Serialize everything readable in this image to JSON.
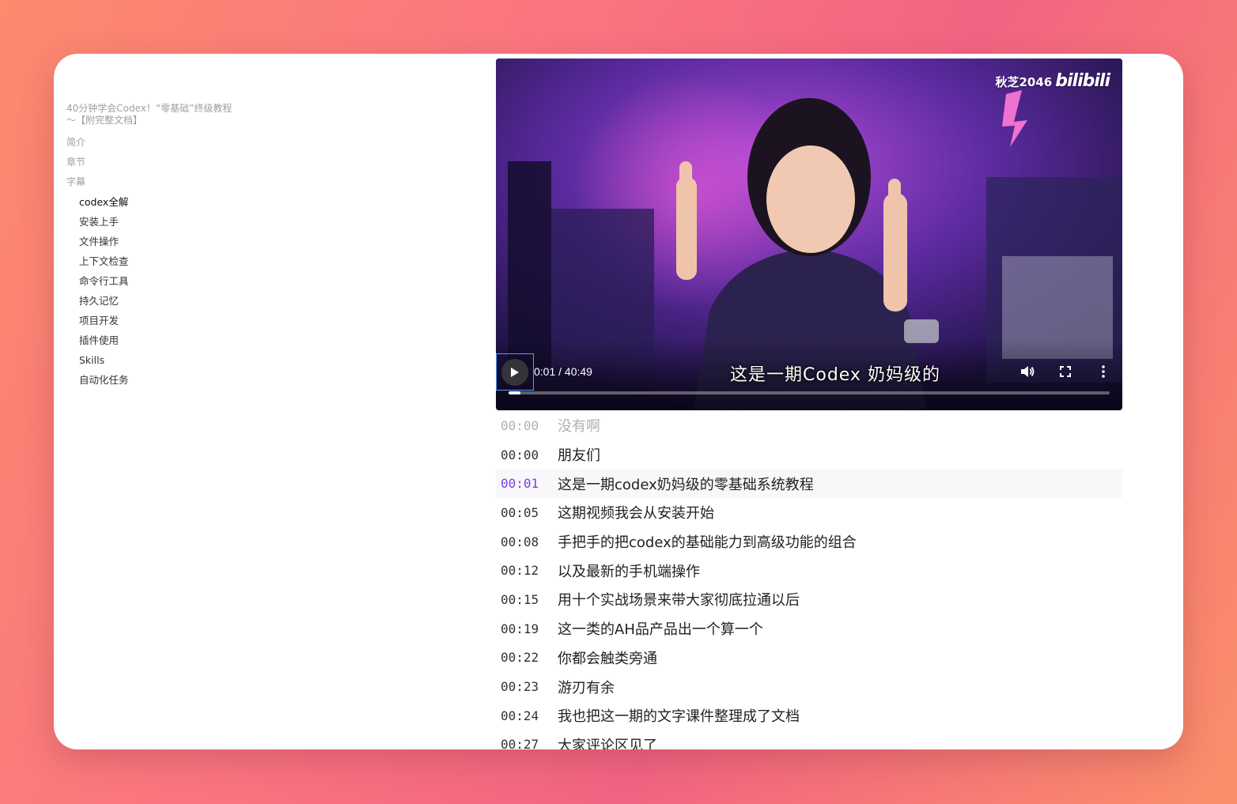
{
  "sidebar": {
    "doc_title": "40分钟学会Codex！“零基础”终级教程～【附完整文档】",
    "nav": [
      "简介",
      "章节",
      "字幕"
    ],
    "chapters": [
      {
        "label": "codex全解",
        "active": true
      },
      {
        "label": "安装上手",
        "active": false
      },
      {
        "label": "文件操作",
        "active": false
      },
      {
        "label": "上下文检查",
        "active": false
      },
      {
        "label": "命令行工具",
        "active": false
      },
      {
        "label": "持久记忆",
        "active": false
      },
      {
        "label": "项目开发",
        "active": false
      },
      {
        "label": "插件使用",
        "active": false
      },
      {
        "label": "Skills",
        "active": false
      },
      {
        "label": "自动化任务",
        "active": false
      }
    ]
  },
  "player": {
    "watermark_user": "秋芝2046",
    "watermark_brand": "bilibili",
    "time": "0:01 / 40:49",
    "burned_subtitle": "这是一期Codex 奶妈级的",
    "progress_fraction": 0.0004,
    "icons": [
      "play-icon",
      "volume-icon",
      "fullscreen-icon",
      "more-options-icon"
    ]
  },
  "transcript": [
    {
      "time": "00:00",
      "text": "没有啊",
      "state": "faded"
    },
    {
      "time": "00:00",
      "text": "朋友们",
      "state": ""
    },
    {
      "time": "00:01",
      "text": "这是一期codex奶妈级的零基础系统教程",
      "state": "current"
    },
    {
      "time": "00:05",
      "text": "这期视频我会从安装开始",
      "state": ""
    },
    {
      "time": "00:08",
      "text": "手把手的把codex的基础能力到高级功能的组合",
      "state": ""
    },
    {
      "time": "00:12",
      "text": "以及最新的手机端操作",
      "state": ""
    },
    {
      "time": "00:15",
      "text": "用十个实战场景来带大家彻底拉通以后",
      "state": ""
    },
    {
      "time": "00:19",
      "text": "这一类的AH品产品出一个算一个",
      "state": ""
    },
    {
      "time": "00:22",
      "text": "你都会触类旁通",
      "state": ""
    },
    {
      "time": "00:23",
      "text": "游刃有余",
      "state": ""
    },
    {
      "time": "00:24",
      "text": "我也把这一期的文字课件整理成了文档",
      "state": ""
    },
    {
      "time": "00:27",
      "text": "大家评论区见了",
      "state": ""
    }
  ],
  "colors": {
    "accent_current": "#7b3fe4",
    "background_start": "#fb8a6e",
    "background_end": "#f26482"
  }
}
